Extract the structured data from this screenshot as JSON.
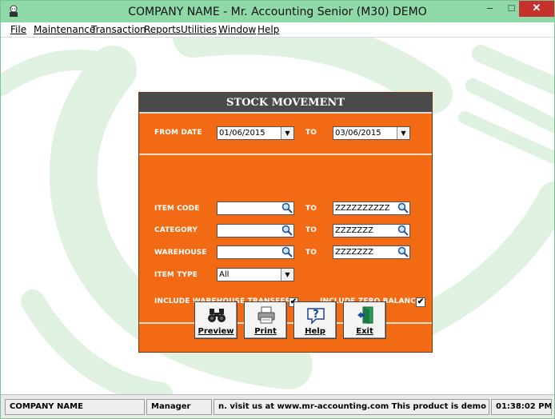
{
  "window": {
    "title": "COMPANY NAME - Mr. Accounting Senior (M30) DEMO",
    "minimize_glyph": "–",
    "maximize_glyph": "□",
    "close_glyph": "✕"
  },
  "menu": {
    "items": [
      "File",
      "Maintenance",
      "Transaction",
      "Reports",
      "Utilities",
      "Window",
      "Help"
    ]
  },
  "dialog": {
    "title": "STOCK MOVEMENT",
    "from_date_label": "FROM DATE",
    "from_date_value": "01/06/2015",
    "to_label": "TO",
    "to_date_value": "03/06/2015",
    "item_code_label": "ITEM CODE",
    "item_code_from": "",
    "item_code_to": "ZZZZZZZZZZ",
    "category_label": "CATEGORY",
    "category_from": "",
    "category_to": "ZZZZZZZ",
    "warehouse_label": "WAREHOUSE",
    "warehouse_from": "",
    "warehouse_to": "ZZZZZZZ",
    "item_type_label": "ITEM TYPE",
    "item_type_value": "All",
    "include_warehouse_transfer_label": "INCLUDE WAREHOUSE TRANSFER",
    "include_warehouse_transfer_checked": true,
    "include_zero_balance_label": "INCLUDE ZERO BALANCE",
    "include_zero_balance_checked": true,
    "check_glyph": "✔",
    "dropdown_glyph": "▼",
    "buttons": {
      "preview": "Preview",
      "print": "Print",
      "help": "Help",
      "exit": "Exit"
    }
  },
  "status": {
    "company": "COMPANY NAME",
    "user": "Manager",
    "message": "n.  visit us at www.mr-accounting.com This product is demo versio",
    "time": "01:38:02 PM"
  },
  "colors": {
    "titlebar": "#8fd9a8",
    "dialog_bg": "#f36a14",
    "dialog_header": "#4a4a4a",
    "close_button": "#c7312c"
  }
}
